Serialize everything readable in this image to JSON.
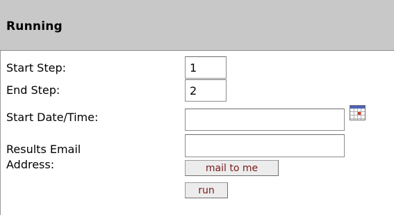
{
  "section": {
    "title": "Running"
  },
  "form": {
    "start_step": {
      "label": "Start Step:",
      "value": "1"
    },
    "end_step": {
      "label": "End Step:",
      "value": "2"
    },
    "start_datetime": {
      "label": "Start Date/Time:",
      "value": ""
    },
    "results_email": {
      "label": "Results Email\nAddress:",
      "value": ""
    }
  },
  "buttons": {
    "mail_to_me": "mail to me",
    "run": "run"
  },
  "icons": {
    "calendar": "calendar-icon"
  }
}
